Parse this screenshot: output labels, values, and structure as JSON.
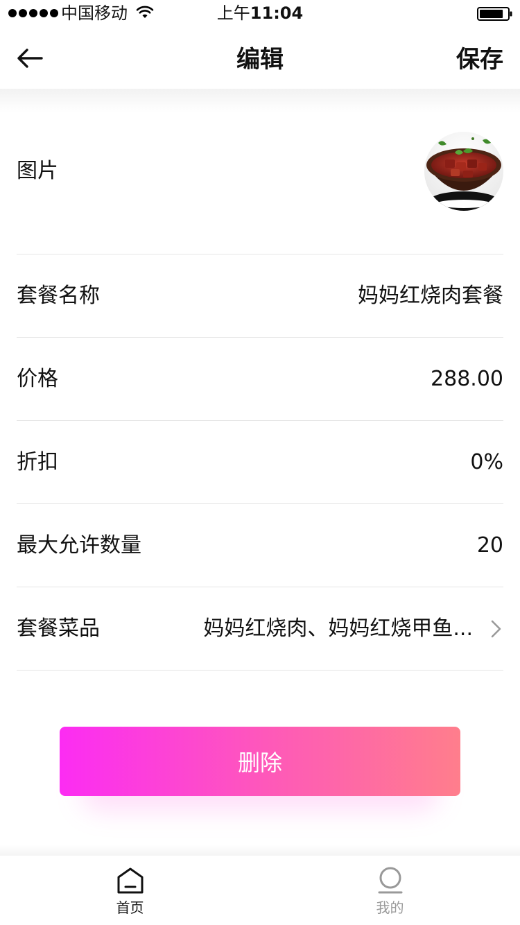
{
  "status_bar": {
    "carrier": "中国移动",
    "time_prefix": "上午",
    "time": "11:04",
    "signal_bars": 5,
    "wifi_icon": "wifi-icon",
    "battery_icon": "battery-icon",
    "battery_level": 0.85
  },
  "nav": {
    "back_icon": "arrow-left-icon",
    "title": "编辑",
    "save_label": "保存"
  },
  "form": {
    "photo_label": "图片",
    "photo_icon": "food-photo-braised-pork",
    "name_label": "套餐名称",
    "name_value": "妈妈红烧肉套餐",
    "price_label": "价格",
    "price_value": "288.00",
    "discount_label": "折扣",
    "discount_value": "0%",
    "max_qty_label": "最大允许数量",
    "max_qty_value": "20",
    "dishes_label": "套餐菜品",
    "dishes_value": "妈妈红烧肉、妈妈红烧甲鱼...",
    "dishes_icon": "chevron-right-icon"
  },
  "delete_button": {
    "label": "删除",
    "gradient_colors": [
      "#fc2cf3",
      "#fe5bb6",
      "#ff7e8c"
    ]
  },
  "tab_bar": {
    "tabs": [
      {
        "label": "首页",
        "icon": "home-icon",
        "active": true
      },
      {
        "label": "我的",
        "icon": "profile-icon",
        "active": false
      }
    ],
    "active_color": "#111111",
    "inactive_color": "#9a9a9a"
  }
}
